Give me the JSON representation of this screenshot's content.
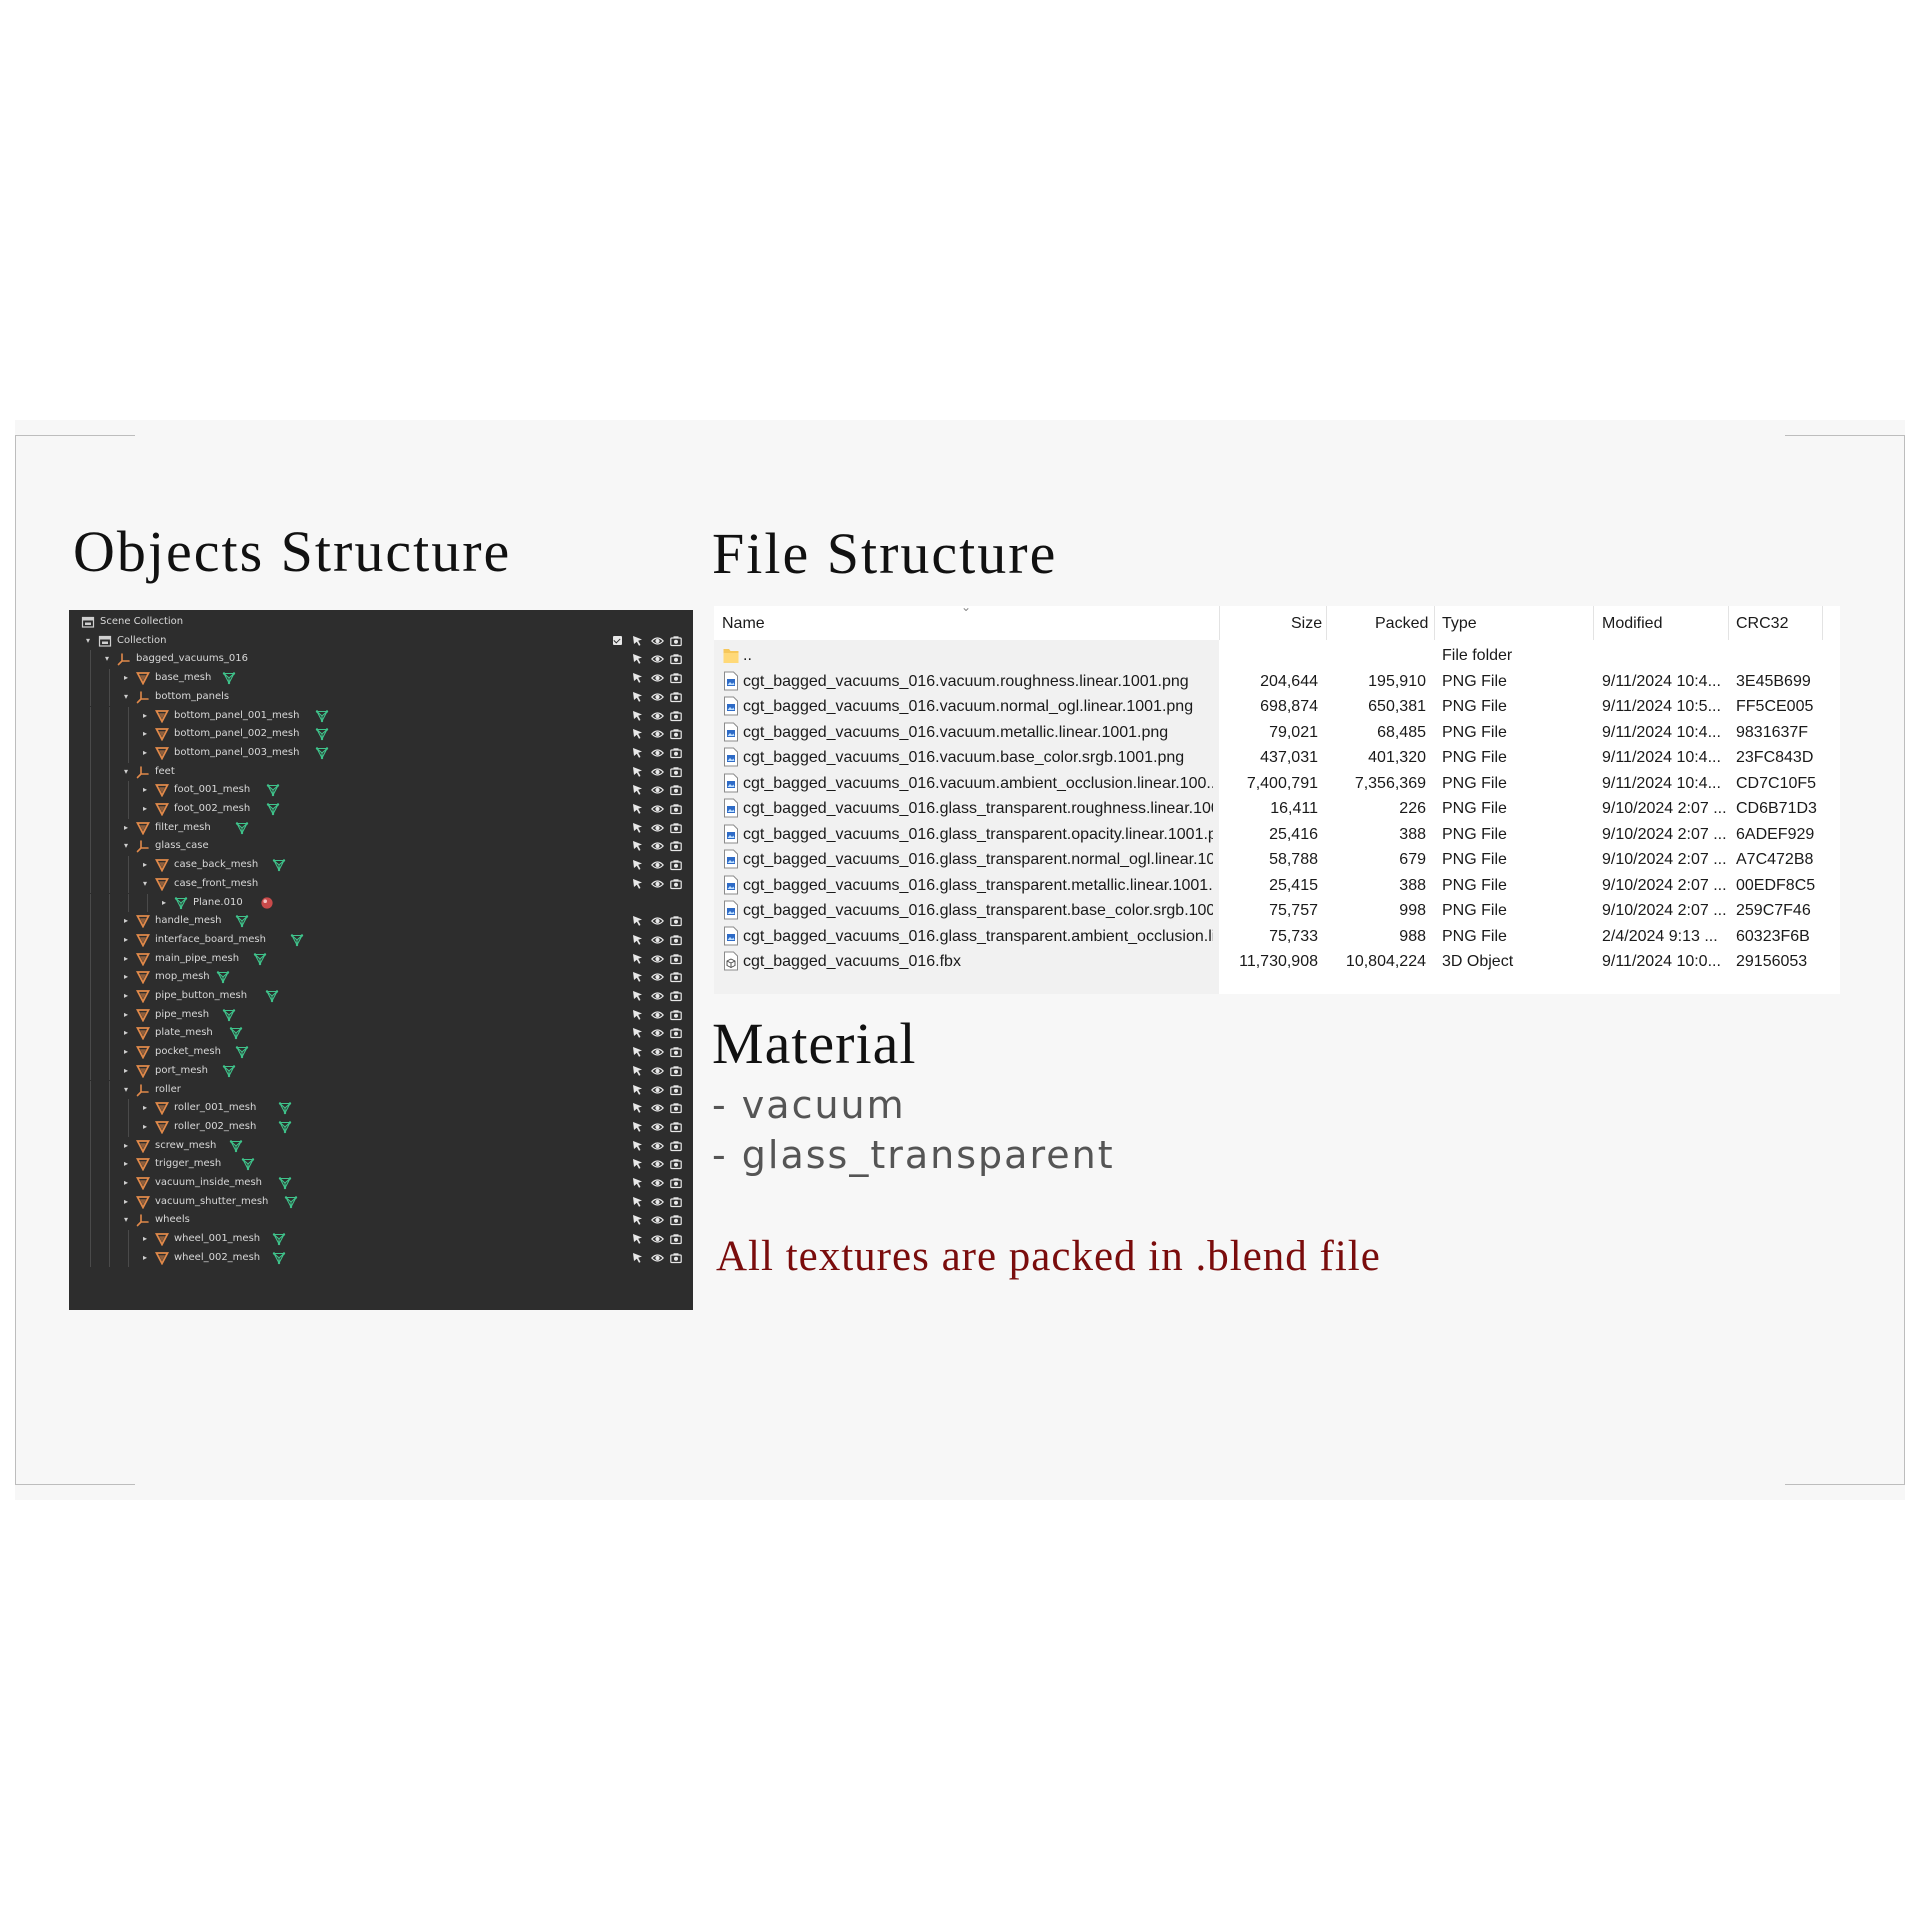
{
  "headings": {
    "objects": "Objects Structure",
    "files": "File Structure",
    "material": "Material"
  },
  "materials": [
    "- vacuum",
    "- glass_transparent"
  ],
  "note": "All textures are packed in .blend file",
  "colors": {
    "note_red": "#7a0c0c",
    "outliner_bg": "#2d2d2d",
    "mesh_orange": "#e0894a",
    "mesh_data_green": "#3fc38b",
    "material_red": "#c94a4a",
    "folder_yellow": "#f6c75a",
    "png_blue": "#2e6bc7"
  },
  "outliner": {
    "rows": [
      {
        "label": "Scene Collection",
        "depth": 0,
        "icon": "scene-collection-icon",
        "arrow": "",
        "data": "",
        "checkbox": false,
        "controls": false
      },
      {
        "label": "Collection",
        "depth": 1,
        "icon": "collection-icon",
        "arrow": "expanded",
        "data": "",
        "checkbox": true,
        "controls": true
      },
      {
        "label": "bagged_vacuums_016",
        "depth": 2,
        "icon": "empty-icon",
        "arrow": "expanded",
        "data": "",
        "checkbox": false,
        "controls": true
      },
      {
        "label": "base_mesh",
        "depth": 3,
        "icon": "mesh-object-icon",
        "arrow": "collapsed",
        "data": "mesh-data-icon",
        "checkbox": false,
        "controls": true
      },
      {
        "label": "bottom_panels",
        "depth": 3,
        "icon": "empty-icon",
        "arrow": "expanded",
        "data": "",
        "checkbox": false,
        "controls": true
      },
      {
        "label": "bottom_panel_001_mesh",
        "depth": 4,
        "icon": "mesh-object-icon",
        "arrow": "collapsed",
        "data": "mesh-data-icon",
        "checkbox": false,
        "controls": true
      },
      {
        "label": "bottom_panel_002_mesh",
        "depth": 4,
        "icon": "mesh-object-icon",
        "arrow": "collapsed",
        "data": "mesh-data-icon",
        "checkbox": false,
        "controls": true
      },
      {
        "label": "bottom_panel_003_mesh",
        "depth": 4,
        "icon": "mesh-object-icon",
        "arrow": "collapsed",
        "data": "mesh-data-icon",
        "checkbox": false,
        "controls": true
      },
      {
        "label": "feet",
        "depth": 3,
        "icon": "empty-icon",
        "arrow": "expanded",
        "data": "",
        "checkbox": false,
        "controls": true
      },
      {
        "label": "foot_001_mesh",
        "depth": 4,
        "icon": "mesh-object-icon",
        "arrow": "collapsed",
        "data": "mesh-data-icon",
        "checkbox": false,
        "controls": true
      },
      {
        "label": "foot_002_mesh",
        "depth": 4,
        "icon": "mesh-object-icon",
        "arrow": "collapsed",
        "data": "mesh-data-icon",
        "checkbox": false,
        "controls": true
      },
      {
        "label": "filter_mesh",
        "depth": 3,
        "icon": "mesh-object-icon",
        "arrow": "collapsed",
        "data": "mesh-data-icon",
        "checkbox": false,
        "controls": true
      },
      {
        "label": "glass_case",
        "depth": 3,
        "icon": "empty-icon",
        "arrow": "expanded",
        "data": "",
        "checkbox": false,
        "controls": true
      },
      {
        "label": "case_back_mesh",
        "depth": 4,
        "icon": "mesh-object-icon",
        "arrow": "collapsed",
        "data": "mesh-data-icon",
        "checkbox": false,
        "controls": true
      },
      {
        "label": "case_front_mesh",
        "depth": 4,
        "icon": "mesh-object-icon",
        "arrow": "expanded",
        "data": "",
        "checkbox": false,
        "controls": true
      },
      {
        "label": "Plane.010",
        "depth": 5,
        "icon": "mesh-data-icon",
        "arrow": "collapsed",
        "data": "material-icon",
        "checkbox": false,
        "controls": false
      },
      {
        "label": "handle_mesh",
        "depth": 3,
        "icon": "mesh-object-icon",
        "arrow": "collapsed",
        "data": "mesh-data-icon",
        "checkbox": false,
        "controls": true
      },
      {
        "label": "interface_board_mesh",
        "depth": 3,
        "icon": "mesh-object-icon",
        "arrow": "collapsed",
        "data": "mesh-data-icon",
        "checkbox": false,
        "controls": true
      },
      {
        "label": "main_pipe_mesh",
        "depth": 3,
        "icon": "mesh-object-icon",
        "arrow": "collapsed",
        "data": "mesh-data-icon",
        "checkbox": false,
        "controls": true
      },
      {
        "label": "mop_mesh",
        "depth": 3,
        "icon": "mesh-object-icon",
        "arrow": "collapsed",
        "data": "mesh-data-icon",
        "checkbox": false,
        "controls": true
      },
      {
        "label": "pipe_button_mesh",
        "depth": 3,
        "icon": "mesh-object-icon",
        "arrow": "collapsed",
        "data": "mesh-data-icon",
        "checkbox": false,
        "controls": true
      },
      {
        "label": "pipe_mesh",
        "depth": 3,
        "icon": "mesh-object-icon",
        "arrow": "collapsed",
        "data": "mesh-data-icon",
        "checkbox": false,
        "controls": true
      },
      {
        "label": "plate_mesh",
        "depth": 3,
        "icon": "mesh-object-icon",
        "arrow": "collapsed",
        "data": "mesh-data-icon",
        "checkbox": false,
        "controls": true
      },
      {
        "label": "pocket_mesh",
        "depth": 3,
        "icon": "mesh-object-icon",
        "arrow": "collapsed",
        "data": "mesh-data-icon",
        "checkbox": false,
        "controls": true
      },
      {
        "label": "port_mesh",
        "depth": 3,
        "icon": "mesh-object-icon",
        "arrow": "collapsed",
        "data": "mesh-data-icon",
        "checkbox": false,
        "controls": true
      },
      {
        "label": "roller",
        "depth": 3,
        "icon": "empty-icon",
        "arrow": "expanded",
        "data": "",
        "checkbox": false,
        "controls": true
      },
      {
        "label": "roller_001_mesh",
        "depth": 4,
        "icon": "mesh-object-icon",
        "arrow": "collapsed",
        "data": "mesh-data-icon",
        "checkbox": false,
        "controls": true
      },
      {
        "label": "roller_002_mesh",
        "depth": 4,
        "icon": "mesh-object-icon",
        "arrow": "collapsed",
        "data": "mesh-data-icon",
        "checkbox": false,
        "controls": true
      },
      {
        "label": "screw_mesh",
        "depth": 3,
        "icon": "mesh-object-icon",
        "arrow": "collapsed",
        "data": "mesh-data-icon",
        "checkbox": false,
        "controls": true
      },
      {
        "label": "trigger_mesh",
        "depth": 3,
        "icon": "mesh-object-icon",
        "arrow": "collapsed",
        "data": "mesh-data-icon",
        "checkbox": false,
        "controls": true
      },
      {
        "label": "vacuum_inside_mesh",
        "depth": 3,
        "icon": "mesh-object-icon",
        "arrow": "collapsed",
        "data": "mesh-data-icon",
        "checkbox": false,
        "controls": true
      },
      {
        "label": "vacuum_shutter_mesh",
        "depth": 3,
        "icon": "mesh-object-icon",
        "arrow": "collapsed",
        "data": "mesh-data-icon",
        "checkbox": false,
        "controls": true
      },
      {
        "label": "wheels",
        "depth": 3,
        "icon": "empty-icon",
        "arrow": "expanded",
        "data": "",
        "checkbox": false,
        "controls": true
      },
      {
        "label": "wheel_001_mesh",
        "depth": 4,
        "icon": "mesh-object-icon",
        "arrow": "collapsed",
        "data": "mesh-data-icon",
        "checkbox": false,
        "controls": true
      },
      {
        "label": "wheel_002_mesh",
        "depth": 4,
        "icon": "mesh-object-icon",
        "arrow": "collapsed",
        "data": "mesh-data-icon",
        "checkbox": false,
        "controls": true
      }
    ]
  },
  "file_table": {
    "columns": [
      "Name",
      "Size",
      "Packed",
      "Type",
      "Modified",
      "CRC32"
    ],
    "rows": [
      {
        "name": "..",
        "size": "",
        "packed": "",
        "type": "File folder",
        "modified": "",
        "crc": "",
        "icon": "folder-icon"
      },
      {
        "name": "cgt_bagged_vacuums_016.vacuum.roughness.linear.1001.png",
        "size": "204,644",
        "packed": "195,910",
        "type": "PNG File",
        "modified": "9/11/2024 10:4...",
        "crc": "3E45B699",
        "icon": "png-file-icon"
      },
      {
        "name": "cgt_bagged_vacuums_016.vacuum.normal_ogl.linear.1001.png",
        "size": "698,874",
        "packed": "650,381",
        "type": "PNG File",
        "modified": "9/11/2024 10:5...",
        "crc": "FF5CE005",
        "icon": "png-file-icon"
      },
      {
        "name": "cgt_bagged_vacuums_016.vacuum.metallic.linear.1001.png",
        "size": "79,021",
        "packed": "68,485",
        "type": "PNG File",
        "modified": "9/11/2024 10:4...",
        "crc": "9831637F",
        "icon": "png-file-icon"
      },
      {
        "name": "cgt_bagged_vacuums_016.vacuum.base_color.srgb.1001.png",
        "size": "437,031",
        "packed": "401,320",
        "type": "PNG File",
        "modified": "9/11/2024 10:4...",
        "crc": "23FC843D",
        "icon": "png-file-icon"
      },
      {
        "name": "cgt_bagged_vacuums_016.vacuum.ambient_occlusion.linear.100...",
        "size": "7,400,791",
        "packed": "7,356,369",
        "type": "PNG File",
        "modified": "9/11/2024 10:4...",
        "crc": "CD7C10F5",
        "icon": "png-file-icon"
      },
      {
        "name": "cgt_bagged_vacuums_016.glass_transparent.roughness.linear.100...",
        "size": "16,411",
        "packed": "226",
        "type": "PNG File",
        "modified": "9/10/2024 2:07 ...",
        "crc": "CD6B71D3",
        "icon": "png-file-icon"
      },
      {
        "name": "cgt_bagged_vacuums_016.glass_transparent.opacity.linear.1001.p...",
        "size": "25,416",
        "packed": "388",
        "type": "PNG File",
        "modified": "9/10/2024 2:07 ...",
        "crc": "6ADEF929",
        "icon": "png-file-icon"
      },
      {
        "name": "cgt_bagged_vacuums_016.glass_transparent.normal_ogl.linear.10...",
        "size": "58,788",
        "packed": "679",
        "type": "PNG File",
        "modified": "9/10/2024 2:07 ...",
        "crc": "A7C472B8",
        "icon": "png-file-icon"
      },
      {
        "name": "cgt_bagged_vacuums_016.glass_transparent.metallic.linear.1001....",
        "size": "25,415",
        "packed": "388",
        "type": "PNG File",
        "modified": "9/10/2024 2:07 ...",
        "crc": "00EDF8C5",
        "icon": "png-file-icon"
      },
      {
        "name": "cgt_bagged_vacuums_016.glass_transparent.base_color.srgb.1001...",
        "size": "75,757",
        "packed": "998",
        "type": "PNG File",
        "modified": "9/10/2024 2:07 ...",
        "crc": "259C7F46",
        "icon": "png-file-icon"
      },
      {
        "name": "cgt_bagged_vacuums_016.glass_transparent.ambient_occlusion.li...",
        "size": "75,733",
        "packed": "988",
        "type": "PNG File",
        "modified": "2/4/2024 9:13 ...",
        "crc": "60323F6B",
        "icon": "png-file-icon"
      },
      {
        "name": "cgt_bagged_vacuums_016.fbx",
        "size": "11,730,908",
        "packed": "10,804,224",
        "type": "3D Object",
        "modified": "9/11/2024 10:0...",
        "crc": "29156053",
        "icon": "3d-object-icon"
      }
    ]
  }
}
